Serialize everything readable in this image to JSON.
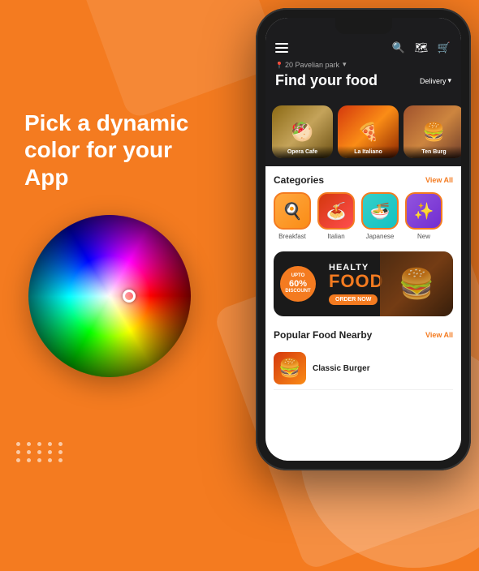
{
  "background": {
    "color": "#F47B20"
  },
  "left_panel": {
    "tagline": "Pick a dynamic color for your App",
    "color_wheel": {
      "indicator_label": "color-wheel-indicator"
    }
  },
  "phone": {
    "header": {
      "location": "20 Pavelian park",
      "location_arrow": "▾",
      "title": "Find your food",
      "delivery_label": "Delivery",
      "delivery_arrow": "▾"
    },
    "food_cards": [
      {
        "name": "Opera Cafe",
        "color_class": "food-img-sandwich"
      },
      {
        "name": "La Italiano",
        "color_class": "food-img-pizza"
      },
      {
        "name": "Ten Burg",
        "color_class": "food-img-burger"
      }
    ],
    "categories": {
      "title": "Categories",
      "view_all": "View All",
      "items": [
        {
          "name": "Breakfast",
          "color_class": "cat-breakfast",
          "emoji": "🍳"
        },
        {
          "name": "Italian",
          "color_class": "cat-italian",
          "emoji": "🍝"
        },
        {
          "name": "Japanese",
          "color_class": "cat-japanese",
          "emoji": "🍜"
        },
        {
          "name": "New",
          "color_class": "cat-new",
          "emoji": "✨"
        }
      ]
    },
    "promo": {
      "discount_label": "UPTO",
      "discount_value": "60%",
      "discount_sub": "DISCOUNT",
      "healty_label": "HEALTY",
      "food_label": "FOOD",
      "order_btn": "ORDER NOW"
    },
    "popular": {
      "title": "Popular Food Nearby",
      "view_all": "View All",
      "items": [
        {
          "name": "Classic Burger"
        }
      ]
    }
  },
  "icons": {
    "hamburger": "≡",
    "search": "🔍",
    "map": "🗺",
    "cart": "🛒",
    "location_pin": "📍"
  }
}
